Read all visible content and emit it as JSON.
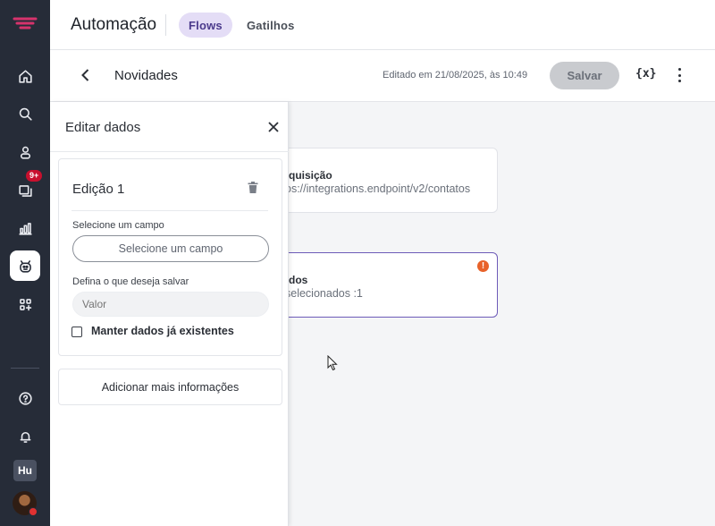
{
  "header": {
    "title": "Automação",
    "tabs": [
      {
        "label": "Flows",
        "active": true
      },
      {
        "label": "Gatilhos",
        "active": false
      }
    ]
  },
  "subheader": {
    "flow_name": "Novidades",
    "edited_text": "Editado em 21/08/2025, às 10:49",
    "save_label": "Salvar"
  },
  "sidebar": {
    "badge": "9+",
    "user_initials": "Hu",
    "items": [
      {
        "icon": "home-icon"
      },
      {
        "icon": "search-icon"
      },
      {
        "icon": "contacts-icon"
      },
      {
        "icon": "chat-icon"
      },
      {
        "icon": "chart-icon"
      },
      {
        "icon": "bot-icon",
        "active": true
      },
      {
        "icon": "apps-icon"
      },
      {
        "icon": "help-icon"
      },
      {
        "icon": "bell-icon"
      }
    ]
  },
  "canvas": {
    "cards": [
      {
        "title": "quisição",
        "subtitle": "os://integrations.endpoint/v2/contatos"
      },
      {
        "title": "dos",
        "subtitle": "selecionados :1",
        "warning": "!"
      }
    ]
  },
  "panel": {
    "title": "Editar dados",
    "edit": {
      "title": "Edição 1",
      "field_label": "Selecione um campo",
      "field_button": "Selecione um campo",
      "value_label": "Defina o que deseja salvar",
      "value_placeholder": "Valor",
      "keep_label": "Manter dados já existentes"
    },
    "add_more_label": "Adicionar mais informações"
  },
  "colors": {
    "rail": "#262c38",
    "accent_tab": "#e4ddf6",
    "selected_card_border": "#6d5bb8",
    "warning": "#e8622a",
    "badge": "#c8102e"
  }
}
